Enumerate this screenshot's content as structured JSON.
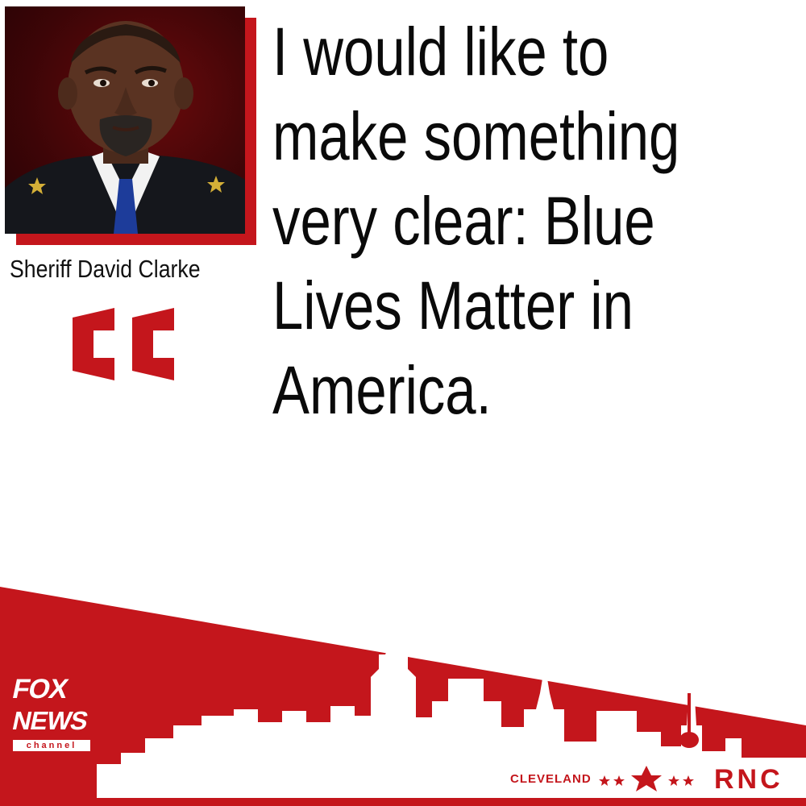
{
  "speaker": {
    "name": "Sheriff David Clarke"
  },
  "quote": {
    "lines": [
      "I would like to",
      "make something",
      "very clear: Blue",
      "Lives Matter in",
      "America."
    ]
  },
  "branding": {
    "network_logo_text": [
      "FOX",
      "NEWS",
      "channel"
    ],
    "city": "CLEVELAND",
    "event": "RNC"
  },
  "colors": {
    "accent": "#c4161c",
    "text": "#0a0a0a",
    "background": "#ffffff"
  }
}
